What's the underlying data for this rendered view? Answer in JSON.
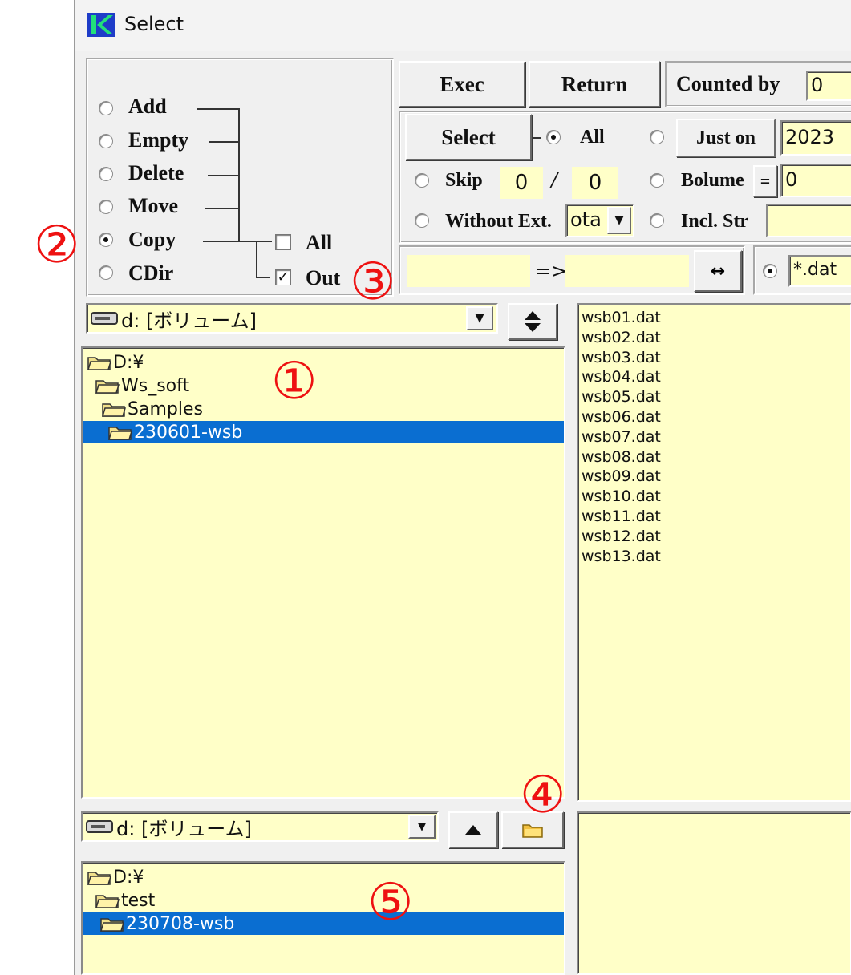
{
  "window": {
    "title": "Select"
  },
  "mode_group": {
    "options": [
      {
        "label": "Add",
        "selected": false
      },
      {
        "label": "Empty",
        "selected": false
      },
      {
        "label": "Delete",
        "selected": false
      },
      {
        "label": "Move",
        "selected": false
      },
      {
        "label": "Copy",
        "selected": true
      },
      {
        "label": "CDir",
        "selected": false
      }
    ],
    "checks": [
      {
        "label": "All",
        "checked": false,
        "mark": ""
      },
      {
        "label": "Out",
        "checked": true,
        "mark": "✓"
      }
    ]
  },
  "toolbar": {
    "exec_label": "Exec",
    "return_label": "Return",
    "counted_by_label": "Counted by",
    "counted_by_value": "0",
    "select_label": "Select",
    "all_label": "All",
    "just_on_label": "Just on",
    "year_value": "2023",
    "skip_label": "Skip",
    "skip_from": "0",
    "skip_sep": "/",
    "skip_to": "0",
    "bolume_label": "Bolume",
    "bolume_op": "=",
    "bolume_value": "0",
    "without_ext_label": "Without Ext.",
    "without_ext_value": "ota",
    "incl_str_label": "Incl. Str",
    "incl_str_value": "",
    "rename_from": "",
    "rename_arrow": "=>",
    "rename_to": "",
    "swap_label": "↔",
    "filter_value": "*.dat"
  },
  "source": {
    "drive": "d: [ボリューム]",
    "tree": [
      {
        "label": "D:¥",
        "indent": 0,
        "selected": false
      },
      {
        "label": "Ws_soft",
        "indent": 1,
        "selected": false
      },
      {
        "label": "Samples",
        "indent": 2,
        "selected": false
      },
      {
        "label": "230601-wsb",
        "indent": 3,
        "selected": true
      }
    ],
    "files": [
      "wsb01.dat",
      "wsb02.dat",
      "wsb03.dat",
      "wsb04.dat",
      "wsb05.dat",
      "wsb06.dat",
      "wsb07.dat",
      "wsb08.dat",
      "wsb09.dat",
      "wsb10.dat",
      "wsb11.dat",
      "wsb12.dat",
      "wsb13.dat"
    ]
  },
  "destination": {
    "drive": "d: [ボリューム]",
    "tree": [
      {
        "label": "D:¥",
        "indent": 0,
        "selected": false
      },
      {
        "label": "test",
        "indent": 1,
        "selected": false
      },
      {
        "label": "230708-wsb",
        "indent": 2,
        "selected": true
      }
    ]
  },
  "annotations": [
    "①",
    "②",
    "③",
    "④",
    "⑤"
  ],
  "icons": {
    "app": "k-logo-icon",
    "drive": "drive-icon",
    "folder": "folder-icon",
    "updown": "up-down-arrows-icon",
    "up": "up-arrow-icon",
    "newfolder": "new-folder-icon"
  },
  "colors": {
    "panel": "#ffffc8",
    "selection": "#0a6ed1",
    "annotation": "#ee1111"
  }
}
